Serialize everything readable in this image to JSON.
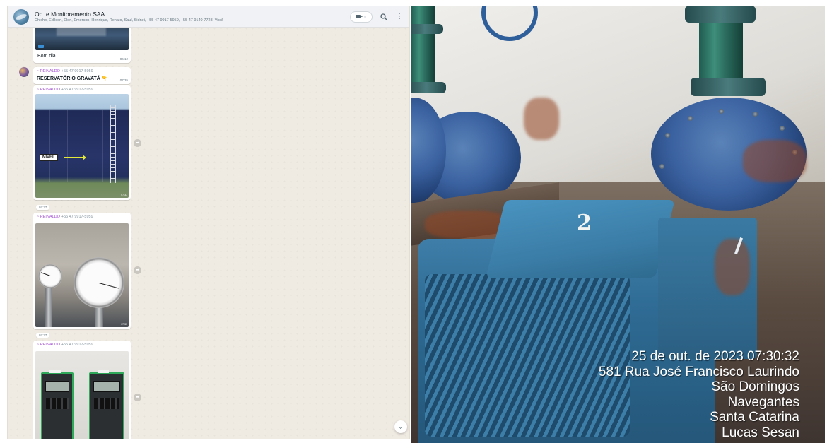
{
  "chat": {
    "header": {
      "group_name": "Op. e Monitoramento SAA",
      "members": "Chicho, Edilson, Elen, Emerson, Henrique, Renato, Saul, Sidnei, +55 47 9917-5959, +55 47 9140-7728, Você",
      "video_chevron": "⌄",
      "search_icon": "search-icon",
      "menu_icon": "⋮"
    },
    "first_message": {
      "thumb_text": "Bom dia",
      "time": "06:12"
    },
    "reply_message": {
      "sender": "~ REINALDO",
      "phone": "+55 47 9917-5959",
      "text": "RESERVATÓRIO GRAVATÁ 👇",
      "time": "07:35"
    },
    "images": [
      {
        "sender": "~ REINALDO",
        "phone": "+55 47 9917-5959",
        "overlay_label": "NÍVEL",
        "stamp_time": "07:37"
      },
      {
        "sender": "~ REINALDO",
        "phone": "+55 47 9917-5959",
        "stamp_time": "07:37"
      },
      {
        "sender": "~ REINALDO",
        "phone": "+55 47 9917-5959"
      }
    ],
    "time_chips": [
      "07:37",
      "07:37"
    ],
    "scroll_down_icon": "⌄"
  },
  "photo": {
    "pump_number": "2",
    "stamp_lines": [
      "25 de out. de 2023 07:30:32",
      "581 Rua José Francisco Laurindo",
      "São Domingos",
      "Navegantes",
      "Santa Catarina",
      "Lucas Sesan"
    ]
  }
}
